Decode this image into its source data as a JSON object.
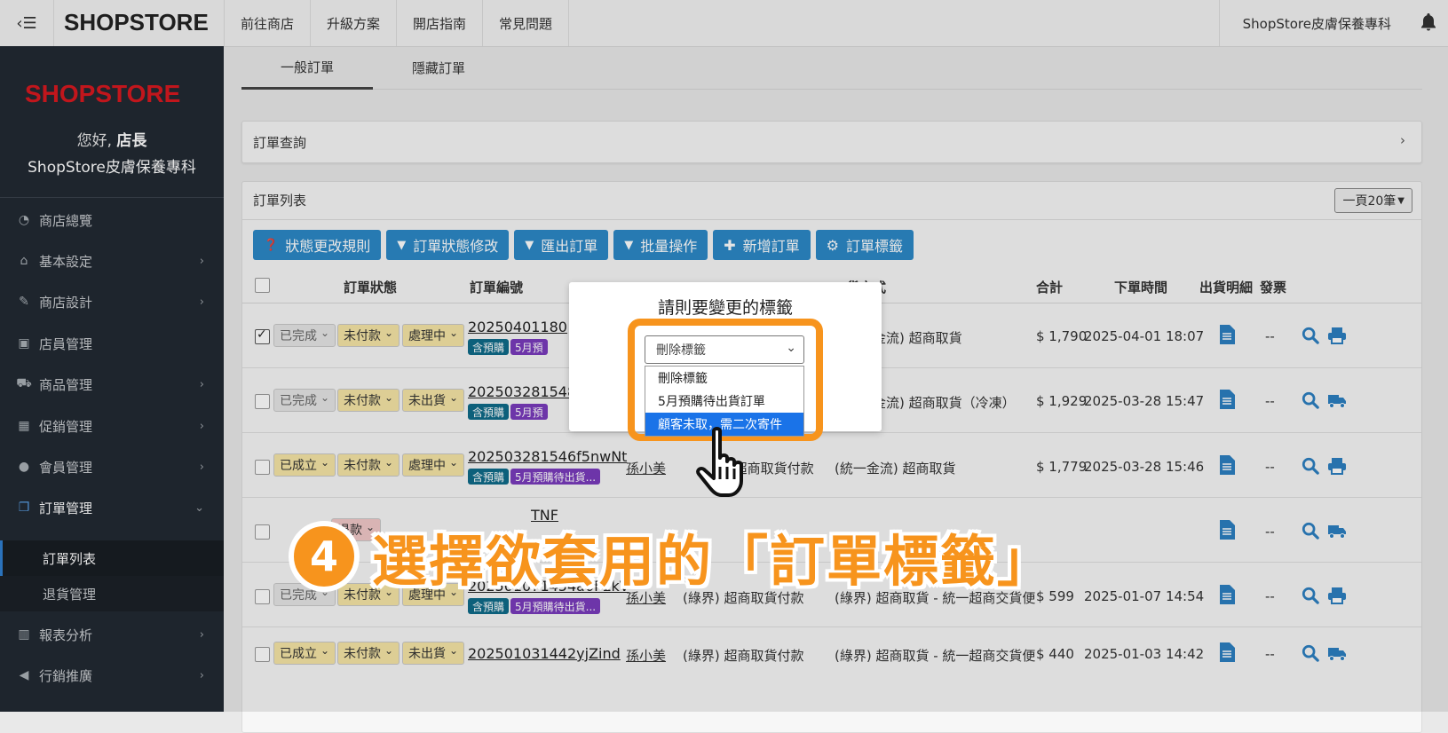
{
  "topbar": {
    "collapse_icon": "menu-collapse-icon",
    "logo": "SHOPSTORE",
    "nav": [
      "前往商店",
      "升級方案",
      "開店指南",
      "常見問題"
    ],
    "shop_name": "ShopStore皮膚保養專科",
    "bell_icon": "bell-icon"
  },
  "sidebar": {
    "logo": "SHOPSTORE",
    "greeting_prefix": "您好, ",
    "greeting_name": "店長",
    "shop_name": "ShopStore皮膚保養專科",
    "items": [
      {
        "label": "商店總覽",
        "icon": "dashboard-icon"
      },
      {
        "label": "基本設定",
        "icon": "bank-icon"
      },
      {
        "label": "商店設計",
        "icon": "magic-wand-icon"
      },
      {
        "label": "店員管理",
        "icon": "lock-icon"
      },
      {
        "label": "商品管理",
        "icon": "cart-icon"
      },
      {
        "label": "促銷管理",
        "icon": "gift-icon"
      },
      {
        "label": "會員管理",
        "icon": "users-icon"
      },
      {
        "label": "訂單管理",
        "icon": "copy-icon"
      },
      {
        "label": "報表分析",
        "icon": "bar-chart-icon"
      },
      {
        "label": "行銷推廣",
        "icon": "bullhorn-icon"
      }
    ],
    "sub_items": [
      "訂單列表",
      "退貨管理"
    ]
  },
  "tabs": [
    "一般訂單",
    "隱藏訂單"
  ],
  "query": {
    "label": "訂單查詢",
    "arrow": "›"
  },
  "orders": {
    "title": "訂單列表",
    "per_page": "一頁20筆",
    "buttons": [
      {
        "label": "狀態更改規則",
        "icon": "question-circle-icon"
      },
      {
        "label": "訂單狀態修改",
        "icon": "caret-down-icon"
      },
      {
        "label": "匯出訂單",
        "icon": "caret-down-icon"
      },
      {
        "label": "批量操作",
        "icon": "caret-down-icon"
      },
      {
        "label": "新增訂單",
        "icon": "plus-icon"
      },
      {
        "label": "訂單標籤",
        "icon": "gear-icon"
      }
    ],
    "columns": [
      "訂單狀態",
      "訂單編號",
      "貨方式",
      "合計",
      "下單時間",
      "出貨明細",
      "發票"
    ],
    "rows": [
      {
        "checked": true,
        "status": "已完成",
        "pay": "未付款",
        "ship": "處理中",
        "order_no": "20250401180",
        "badges": [
          "含預購",
          "5月預"
        ],
        "buyer": "",
        "payment": "",
        "shipping": "統一金流) 超商取貨",
        "total": "$ 1,790",
        "time": "2025-04-01 18:07",
        "invoice": "--",
        "action": "print"
      },
      {
        "checked": false,
        "status": "已完成",
        "pay": "未付款",
        "ship": "未出貨",
        "order_no": "202503281548",
        "badges": [
          "含預購",
          "5月預"
        ],
        "buyer": "",
        "payment": "",
        "shipping": "統一金流) 超商取貨（冷凍）",
        "total": "$ 1,929",
        "time": "2025-03-28 15:47",
        "invoice": "--",
        "action": "truck"
      },
      {
        "checked": false,
        "status": "已成立",
        "pay": "未付款",
        "ship": "處理中",
        "order_no": "202503281546f5nwNt",
        "badges": [
          "含預購",
          "5月預購待出貨..."
        ],
        "buyer": "孫小美",
        "payment": "充) 超商取貨付款",
        "shipping": "(統一金流) 超商取貨",
        "total": "$ 1,779",
        "time": "2025-03-28 15:46",
        "invoice": "--",
        "action": "print"
      },
      {
        "checked": false,
        "status": "退款",
        "pay": "",
        "ship": "",
        "order_no": "TNF",
        "badges": [],
        "buyer": "",
        "payment": "",
        "shipping": "",
        "total": "",
        "time": "",
        "invoice": "--",
        "action": "truck"
      },
      {
        "checked": false,
        "status": "已完成",
        "pay": "未付款",
        "ship": "處理中",
        "order_no": "202501071454a0FEkV",
        "badges": [
          "含預購",
          "5月預購待出貨..."
        ],
        "buyer": "孫小美",
        "payment": "(綠界) 超商取貨付款",
        "shipping": "(綠界) 超商取貨 - 統一超商交貨便",
        "total": "$ 599",
        "time": "2025-01-07 14:54",
        "invoice": "--",
        "action": "print"
      },
      {
        "checked": false,
        "status": "已成立",
        "pay": "未付款",
        "ship": "未出貨",
        "order_no": "202501031442yjZind",
        "badges": [],
        "buyer": "孫小美",
        "payment": "(綠界) 超商取貨付款",
        "shipping": "(綠界) 超商取貨 - 統一超商交貨便",
        "total": "$ 440",
        "time": "2025-01-03 14:42",
        "invoice": "--",
        "action": "truck"
      }
    ]
  },
  "modal": {
    "title": "請則要變更的標籤",
    "select_value": "刪除標籤",
    "options": [
      "刪除標籤",
      "5月預購待出貨訂單",
      "顧客未取，需二次寄件"
    ],
    "selected_index": 2
  },
  "caption": {
    "step": "4",
    "text": "選擇欲套用的「訂單標籤」"
  },
  "colors": {
    "accent": "#f7941d",
    "button": "#2c88c7",
    "sidebar": "#222a33",
    "brand_red": "#d71920"
  }
}
